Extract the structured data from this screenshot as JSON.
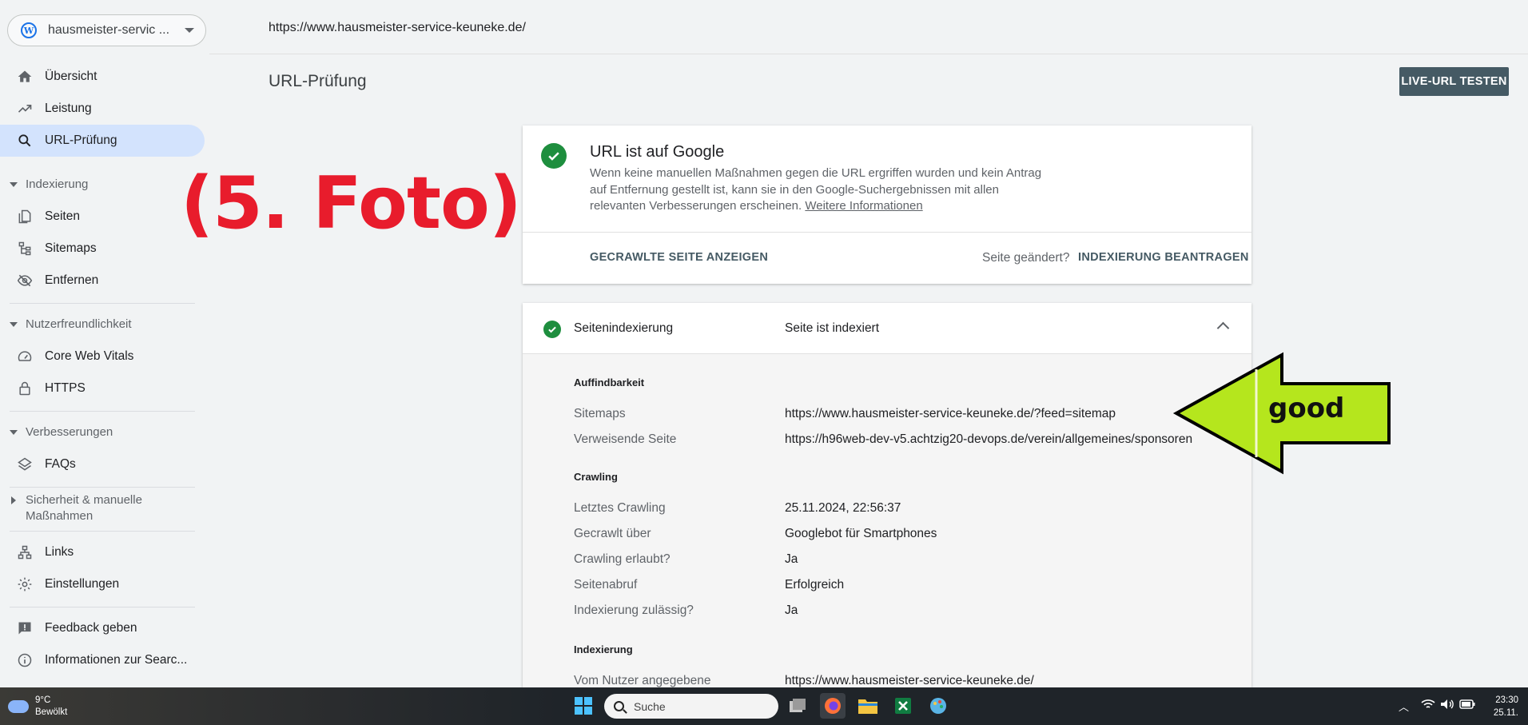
{
  "property": {
    "label": "hausmeister-servic ..."
  },
  "sidebar": {
    "items": [
      {
        "label": "Übersicht",
        "icon": "home-icon"
      },
      {
        "label": "Leistung",
        "icon": "trending-up-icon"
      },
      {
        "label": "URL-Prüfung",
        "icon": "search-icon"
      },
      {
        "label": "Seiten",
        "icon": "pages-icon"
      },
      {
        "label": "Sitemaps",
        "icon": "sitemap-icon"
      },
      {
        "label": "Entfernen",
        "icon": "eye-off-icon"
      },
      {
        "label": "Core Web Vitals",
        "icon": "gauge-icon"
      },
      {
        "label": "HTTPS",
        "icon": "lock-icon"
      },
      {
        "label": "FAQs",
        "icon": "layers-icon"
      },
      {
        "label": "Links",
        "icon": "links-icon"
      },
      {
        "label": "Einstellungen",
        "icon": "gear-icon"
      },
      {
        "label": "Feedback geben",
        "icon": "feedback-icon"
      },
      {
        "label": "Informationen zur Searc...",
        "icon": "info-icon"
      }
    ],
    "sections": {
      "indexing": "Indexierung",
      "usability": "Nutzerfreundlichkeit",
      "enhancements": "Verbesserungen",
      "security_1": "Sicherheit & manuelle",
      "security_2": "Maßnahmen"
    }
  },
  "header": {
    "url": "https://www.hausmeister-service-keuneke.de/",
    "title": "URL-Prüfung",
    "live_test": "LIVE-URL TESTEN"
  },
  "status": {
    "title": "URL ist auf Google",
    "description": "Wenn keine manuellen Maßnahmen gegen die URL ergriffen wurden und kein Antrag auf Entfernung gestellt ist, kann sie in den Google-Suchergebnissen mit allen relevanten Verbesserungen erscheinen.",
    "more": "Weitere Informationen",
    "crawled_page": "GECRAWLTE SEITE ANZEIGEN",
    "changed": "Seite geändert?",
    "request_indexing": "INDEXIERUNG BEANTRAGEN"
  },
  "details": {
    "label": "Seitenindexierung",
    "value": "Seite ist indexiert",
    "discovery": {
      "heading": "Auffindbarkeit",
      "sitemaps_label": "Sitemaps",
      "sitemaps_value": "https://www.hausmeister-service-keuneke.de/?feed=sitemap",
      "referrer_label": "Verweisende Seite",
      "referrer_value": "https://h96web-dev-v5.achtzig20-devops.de/verein/allgemeines/sponsoren"
    },
    "crawling": {
      "heading": "Crawling",
      "rows": [
        {
          "label": "Letztes Crawling",
          "value": "25.11.2024, 22:56:37"
        },
        {
          "label": "Gecrawlt über",
          "value": "Googlebot für Smartphones"
        },
        {
          "label": "Crawling erlaubt?",
          "value": "Ja"
        },
        {
          "label": "Seitenabruf",
          "value": "Erfolgreich"
        },
        {
          "label": "Indexierung zulässig?",
          "value": "Ja"
        }
      ]
    },
    "indexing": {
      "heading": "Indexierung",
      "canonical_label": "Vom Nutzer angegebene",
      "canonical_value": "https://www.hausmeister-service-keuneke.de/"
    }
  },
  "overlay": {
    "foto": "(5. Foto)",
    "good": "good"
  },
  "taskbar": {
    "temp": "9°C",
    "weather": "Bewölkt",
    "search": "Suche",
    "time": "23:30",
    "date": "25.11."
  },
  "colors": {
    "accent": "#1a73e8",
    "success": "#1e8e3e",
    "active_nav": "#d3e3fd",
    "annotation_red": "#e81c2c",
    "arrow_green": "#b5e61d"
  }
}
